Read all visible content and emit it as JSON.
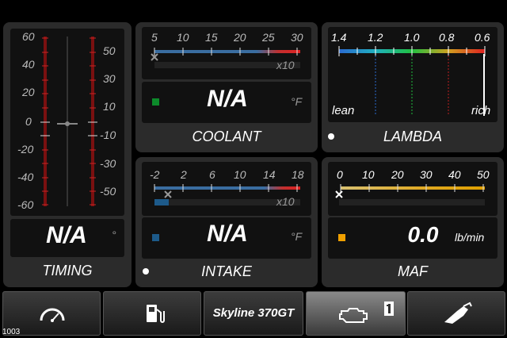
{
  "timing": {
    "title": "TIMING",
    "value": "N/A",
    "unit": "°",
    "left_ticks": [
      "60",
      "40",
      "20",
      "0",
      "-20",
      "-40",
      "-60"
    ],
    "right_ticks": [
      "50",
      "30",
      "10",
      "-10",
      "-30",
      "-50"
    ]
  },
  "coolant": {
    "title": "COOLANT",
    "value": "N/A",
    "unit": "°F",
    "ticks": [
      "5",
      "10",
      "15",
      "20",
      "25",
      "30"
    ],
    "multiplier": "x10",
    "indicator_color": "#0c8a2a"
  },
  "lambda": {
    "title": "LAMBDA",
    "ticks": [
      "1.4",
      "1.2",
      "1.0",
      "0.8",
      "0.6"
    ],
    "lean_label": "lean",
    "rich_label": "rich"
  },
  "intake": {
    "title": "INTAKE",
    "value": "N/A",
    "unit": "°F",
    "ticks": [
      "-2",
      "2",
      "6",
      "10",
      "14",
      "18"
    ],
    "multiplier": "x10",
    "indicator_color": "#1d5a8a"
  },
  "maf": {
    "title": "MAF",
    "value": "0.0",
    "unit": "lb/min",
    "ticks": [
      "0",
      "10",
      "20",
      "30",
      "40",
      "50"
    ],
    "indicator_color": "#f0a000"
  },
  "nav": {
    "items": [
      {
        "name": "gauge",
        "label": ""
      },
      {
        "name": "fuel",
        "label": ""
      },
      {
        "name": "vehicle",
        "label": "Skyline 370GT"
      },
      {
        "name": "engine",
        "label": ""
      },
      {
        "name": "pump",
        "label": ""
      }
    ]
  },
  "version_tag": "1003"
}
